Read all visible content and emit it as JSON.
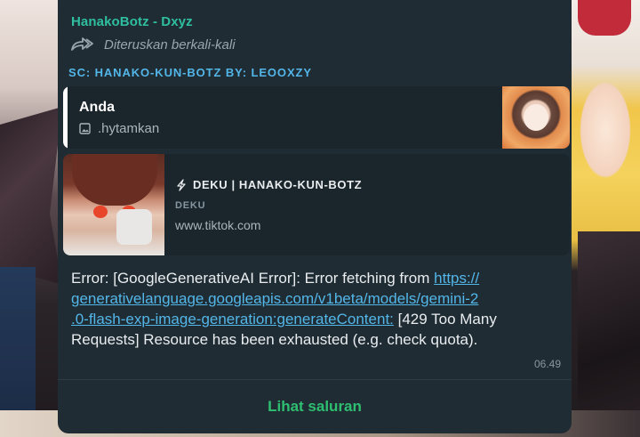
{
  "message": {
    "sender_name": "HanakoBotz - Dxyz",
    "forwarded_label": "Diteruskan berkali-kali",
    "channel_title": "SC: HANAKO-KUN-BOTZ BY: LEOOXZY",
    "quoted": {
      "author": "Anda",
      "icon": "image-icon",
      "text": ".hytamkan"
    },
    "link_preview": {
      "icon": "bolt-icon",
      "title": "DEKU | HANAKO-KUN-BOTZ",
      "description": "DEKU",
      "domain": "www.tiktok.com"
    },
    "body": {
      "prefix": "Error: [GoogleGenerativeAI Error]: Error fetching from ",
      "link": "https://generativelanguage.googleapis.com/v1beta/models/gemini-2.0-flash-exp-image-generation:generateContent:",
      "link_line1": "https://",
      "link_line2": "generativelanguage.googleapis.com/v1beta/models/gemini-2",
      "link_line3": ".0-flash-exp-image-generation:generateContent:",
      "suffix_line3": " [429 Too Many",
      "suffix_line4": "Requests] Resource has been exhausted (e.g. check quota)."
    },
    "timestamp": "06.49",
    "action_label": "Lihat saluran"
  },
  "colors": {
    "bubble_bg": "#1f2c34",
    "sender": "#2fbfa0",
    "link": "#53b6e8",
    "action": "#2fbf71"
  }
}
